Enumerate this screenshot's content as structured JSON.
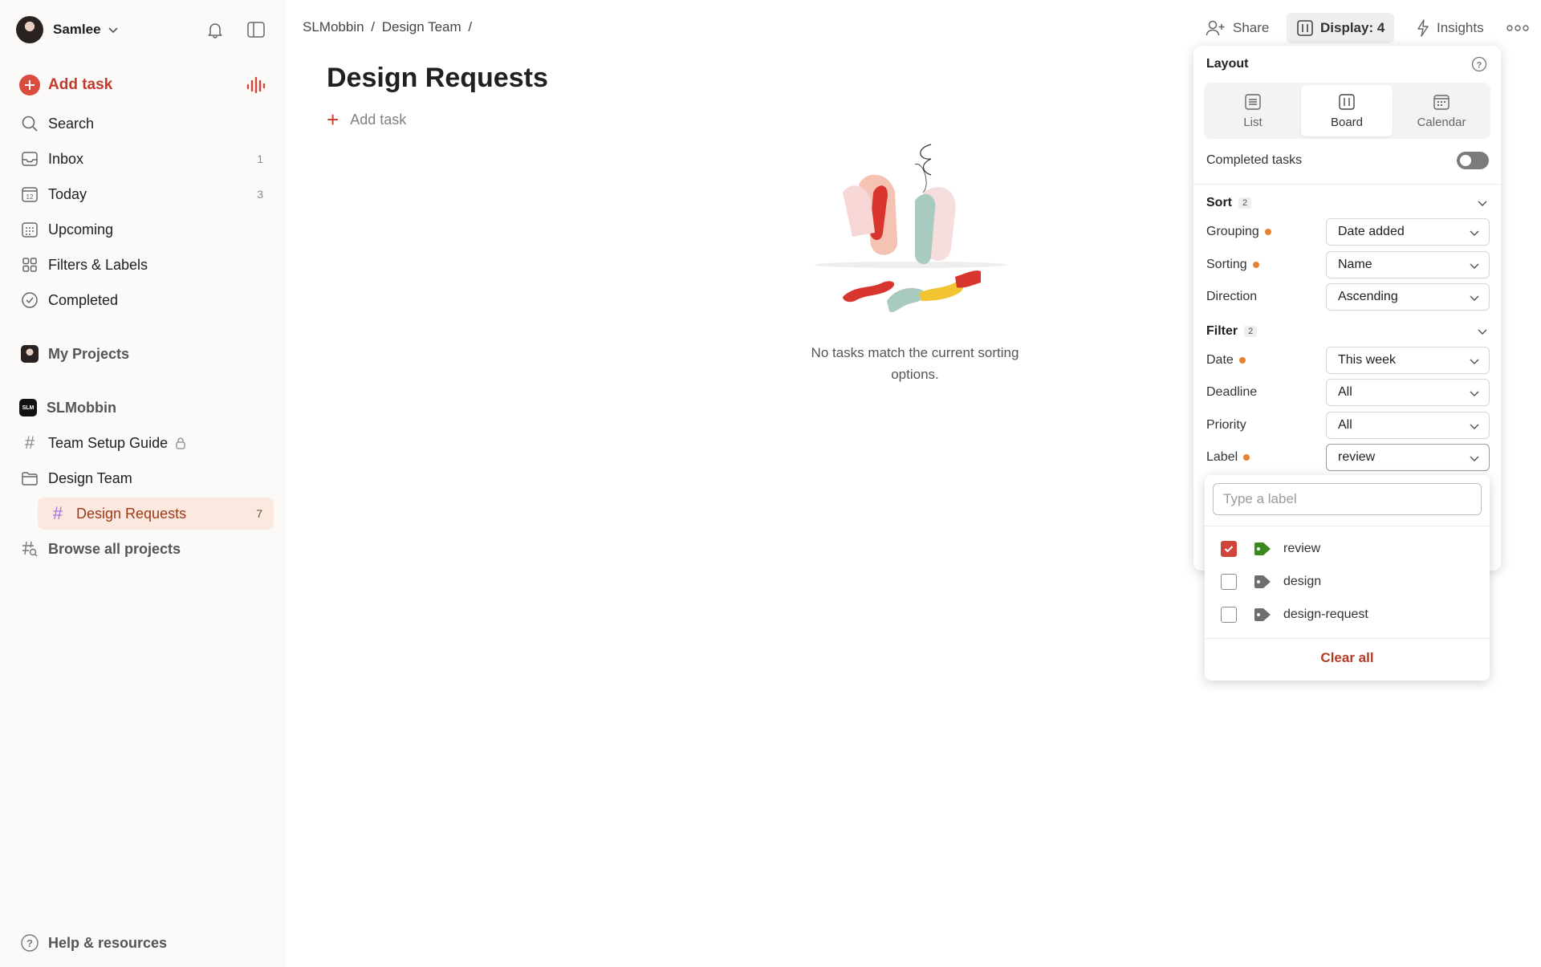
{
  "user": {
    "name": "Samlee"
  },
  "sidebar": {
    "add_task": "Add task",
    "nav": [
      {
        "label": "Search",
        "count": ""
      },
      {
        "label": "Inbox",
        "count": "1"
      },
      {
        "label": "Today",
        "count": "3"
      },
      {
        "label": "Upcoming",
        "count": ""
      },
      {
        "label": "Filters & Labels",
        "count": ""
      },
      {
        "label": "Completed",
        "count": ""
      }
    ],
    "my_projects": "My Projects",
    "workspace": "SLMobbin",
    "workspace_icon_text": "SLM",
    "projects": [
      {
        "label": "Team Setup Guide"
      },
      {
        "label": "Design Team"
      },
      {
        "label": "Design Requests",
        "count": "7"
      }
    ],
    "browse": "Browse all projects",
    "help": "Help & resources"
  },
  "breadcrumb": {
    "parts": [
      "SLMobbin",
      "/",
      "Design Team",
      "/"
    ]
  },
  "header": {
    "share": "Share",
    "display": "Display: 4",
    "insights": "Insights"
  },
  "main": {
    "title": "Design Requests",
    "add_task": "Add task",
    "empty_line1": "No tasks match the current sorting",
    "empty_line2": "options."
  },
  "display_panel": {
    "layout_title": "Layout",
    "layouts": [
      "List",
      "Board",
      "Calendar"
    ],
    "active_layout": "Board",
    "completed_tasks": "Completed tasks",
    "completed_on": false,
    "sort": {
      "title": "Sort",
      "badge": "2"
    },
    "grouping": {
      "label": "Grouping",
      "value": "Date added"
    },
    "sorting": {
      "label": "Sorting",
      "value": "Name"
    },
    "direction": {
      "label": "Direction",
      "value": "Ascending"
    },
    "filter": {
      "title": "Filter",
      "badge": "2"
    },
    "date": {
      "label": "Date",
      "value": "This week"
    },
    "deadline": {
      "label": "Deadline",
      "value": "All"
    },
    "priority": {
      "label": "Priority",
      "value": "All"
    },
    "label": {
      "label": "Label",
      "value": "review"
    }
  },
  "label_dropdown": {
    "placeholder": "Type a label",
    "options": [
      {
        "name": "review",
        "checked": true,
        "color": "#3c8a1e"
      },
      {
        "name": "design",
        "checked": false,
        "color": "#6e6e6e"
      },
      {
        "name": "design-request",
        "checked": false,
        "color": "#6e6e6e"
      }
    ],
    "clear": "Clear all"
  },
  "colors": {
    "accent": "#dc4c3e",
    "active_bg": "#fbe9df",
    "status_dot": "#e6822f"
  }
}
